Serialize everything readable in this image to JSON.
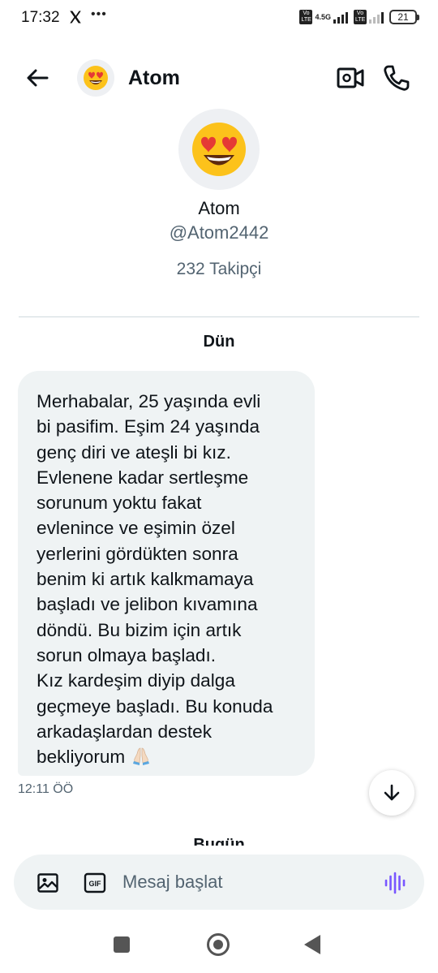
{
  "status_bar": {
    "time": "17:32",
    "dots": "•••",
    "network_label": "4.5G",
    "volte_label": "Vo LTE",
    "battery": "21"
  },
  "header": {
    "name": "Atom",
    "avatar_icon": "heart-eyes-emoji"
  },
  "profile": {
    "name": "Atom",
    "handle": "@Atom2442",
    "followers": "232 Takipçi"
  },
  "conversation": {
    "date_label": "Dün",
    "messages": [
      {
        "text": "Merhabalar, 25 yaşında evli\nbi pasifim. Eşim 24 yaşında\ngenç diri ve ateşli bi kız.\nEvlenene kadar sertleşme\nsorunum yoktu fakat\nevlenince ve eşimin özel\nyerlerini gördükten sonra\nbenim ki artık kalkmamaya\nbaşladı ve jelibon kıvamına\ndöndü. Bu bizim için artık\nsorun olmaya başladı.\nKız kardeşim diyip dalga\ngeçmeye başladı. Bu konuda\narkadaşlardan destek\nbekliyorum",
        "emoji": "folded-hands-emoji",
        "time": "12:11 ÖÖ"
      }
    ],
    "next_date_label_partial": "Bugün"
  },
  "composer": {
    "placeholder": "Mesaj başlat",
    "value": ""
  },
  "colors": {
    "text_primary": "#0f1419",
    "text_secondary": "#536471",
    "bubble_bg": "#eff3f4",
    "accent_voice": "#7856ff"
  }
}
